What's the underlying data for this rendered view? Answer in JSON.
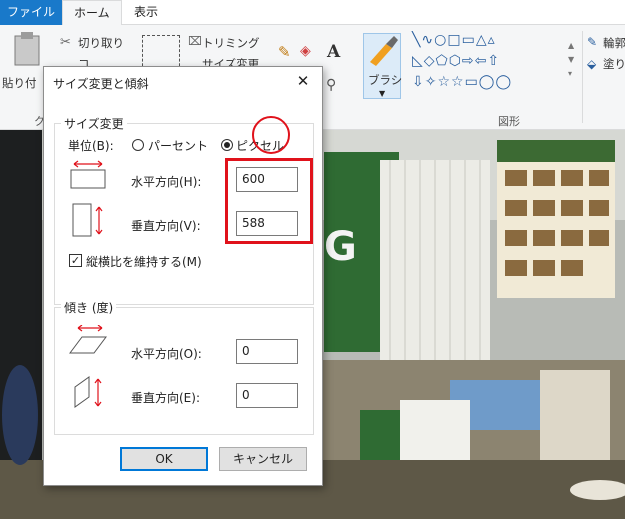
{
  "menubar": {
    "file": "ファイル",
    "home": "ホーム",
    "view": "表示"
  },
  "ribbon": {
    "paste": "貼り付",
    "cut": "切り取り",
    "copy": "コ",
    "trimming": "トリミング",
    "resize": "サイズ変更",
    "brush": "ブラシ",
    "shapes_label": "図形",
    "clipboard_label": "ク",
    "outline": "輪郭",
    "fill": "塗り",
    "text_tool": "A"
  },
  "dialog": {
    "title": "サイズ変更と傾斜",
    "close": "✕",
    "resize_group": "サイズ変更",
    "unit_label": "単位(B):",
    "percent": "パーセント",
    "pixel": "ピクセル",
    "horizontal_label": "水平方向(H):",
    "horizontal_value": "600",
    "vertical_label": "垂直方向(V):",
    "vertical_value": "588",
    "keep_ratio": "縦横比を維持する(M)",
    "skew_group": "傾き (度)",
    "skew_h_label": "水平方向(O):",
    "skew_h_value": "0",
    "skew_v_label": "垂直方向(E):",
    "skew_v_value": "0",
    "ok": "OK",
    "cancel": "キャンセル"
  },
  "colors": {
    "file_tab": "#1979ca",
    "annotation": "#e0121b",
    "ok_border": "#0078d7"
  }
}
